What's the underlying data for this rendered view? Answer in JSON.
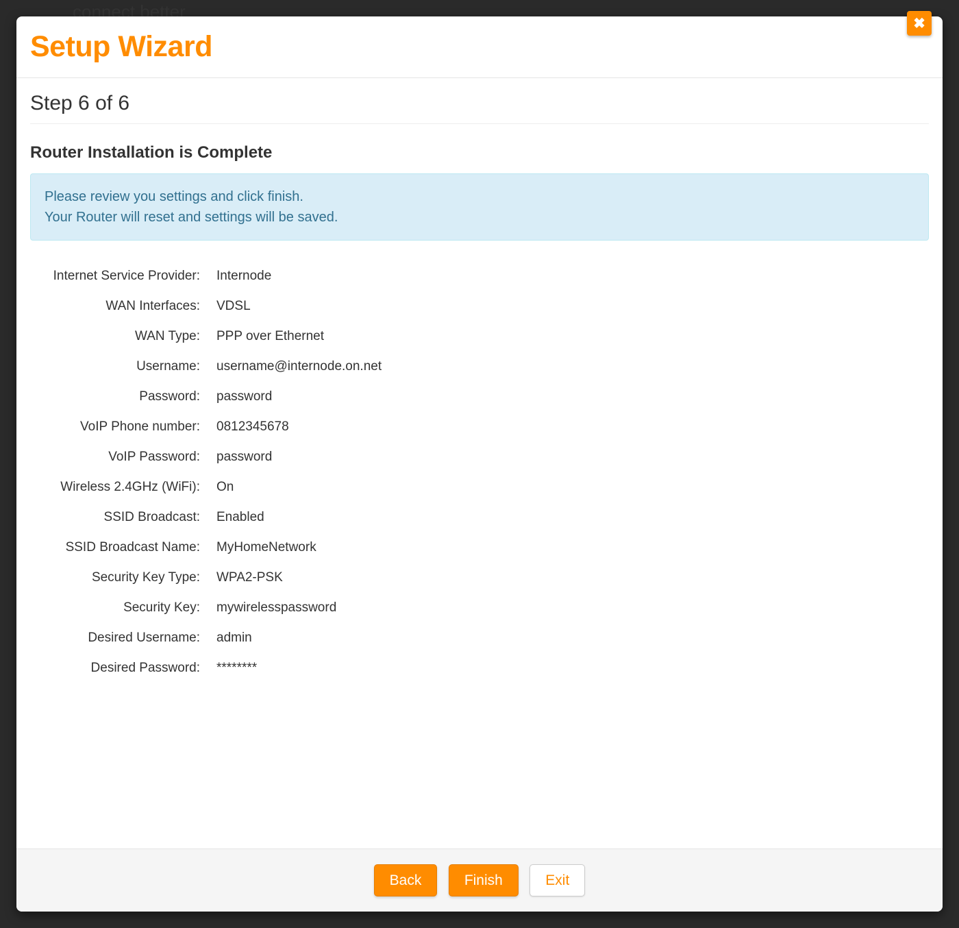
{
  "background": {
    "text_fragment": "connect better"
  },
  "modal": {
    "title": "Setup Wizard",
    "close_icon": "✖",
    "step_heading": "Step 6 of 6",
    "section_title": "Router Installation is Complete",
    "info": {
      "line1": "Please review you settings and click finish.",
      "line2": "Your Router will reset and settings will be saved."
    },
    "settings": [
      {
        "label": "Internet Service Provider:",
        "value": "Internode"
      },
      {
        "label": "WAN Interfaces:",
        "value": "VDSL"
      },
      {
        "label": "WAN Type:",
        "value": "PPP over Ethernet"
      },
      {
        "label": "Username:",
        "value": "username@internode.on.net"
      },
      {
        "label": "Password:",
        "value": "password"
      },
      {
        "label": "VoIP Phone number:",
        "value": "0812345678"
      },
      {
        "label": "VoIP Password:",
        "value": "password"
      },
      {
        "label": "Wireless 2.4GHz (WiFi):",
        "value": "On"
      },
      {
        "label": "SSID Broadcast:",
        "value": "Enabled"
      },
      {
        "label": "SSID Broadcast Name:",
        "value": "MyHomeNetwork"
      },
      {
        "label": "Security Key Type:",
        "value": "WPA2-PSK"
      },
      {
        "label": "Security Key:",
        "value": "mywirelesspassword"
      },
      {
        "label": "Desired Username:",
        "value": "admin"
      },
      {
        "label": "Desired Password:",
        "value": "********"
      }
    ],
    "footer": {
      "back": "Back",
      "finish": "Finish",
      "exit": "Exit"
    }
  }
}
